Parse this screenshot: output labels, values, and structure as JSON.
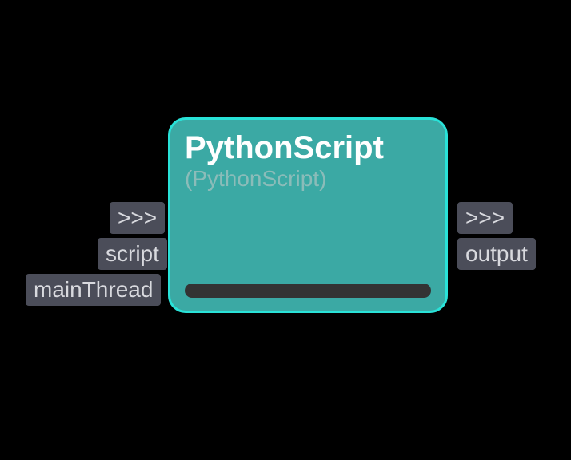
{
  "node": {
    "title": "PythonScript",
    "subtitle": "(PythonScript)"
  },
  "inputs": {
    "exec": ">>>",
    "script": "script",
    "mainThread": "mainThread"
  },
  "outputs": {
    "exec": ">>>",
    "output": "output"
  }
}
